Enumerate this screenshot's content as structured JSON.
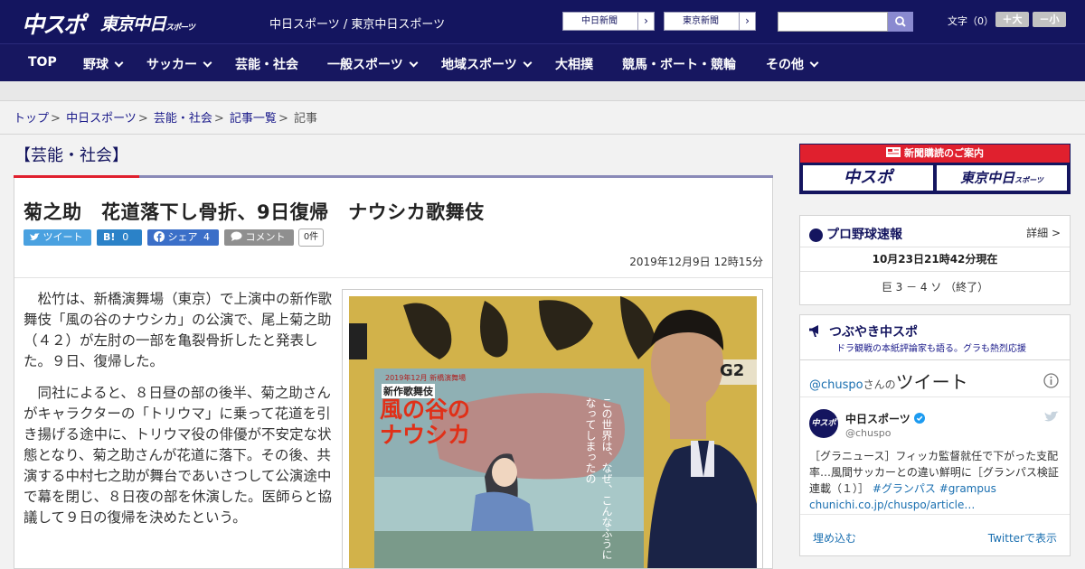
{
  "header": {
    "logo_chuspo": "中スポ",
    "logo_tokyo": "東京中日",
    "logo_tokyo_small": "スポーツ",
    "site_names": "中日スポーツ / 東京中日スポーツ",
    "paper1": "中日新聞",
    "paper2": "東京新聞",
    "arrow": "›",
    "font_label": "文字（0）",
    "font_up": "＋大",
    "font_down": "－小",
    "search_placeholder": ""
  },
  "nav": [
    {
      "label": "TOP",
      "chev": false
    },
    {
      "label": "野球",
      "chev": true
    },
    {
      "label": "サッカー",
      "chev": true
    },
    {
      "label": "芸能・社会",
      "chev": false
    },
    {
      "label": "一般スポーツ",
      "chev": true
    },
    {
      "label": "地域スポーツ",
      "chev": true
    },
    {
      "label": "大相撲",
      "chev": false
    },
    {
      "label": "競馬・ボート・競輪",
      "chev": false
    },
    {
      "label": "その他",
      "chev": true
    }
  ],
  "breadcrumb": {
    "items": [
      "トップ",
      "中日スポーツ",
      "芸能・社会",
      "記事一覧"
    ],
    "current": "記事",
    "sep": ">"
  },
  "section_title": "【芸能・社会】",
  "article": {
    "headline": "菊之助　花道落下し骨折、9日復帰　ナウシカ歌舞伎",
    "tweet": "ツイート",
    "hatena": "B!",
    "hatena_count": "0",
    "fb": "シェア",
    "fb_count": "4",
    "comment": "コメント",
    "comment_count": "0件",
    "date": "2019年12月9日 12時15分",
    "paragraphs": [
      "松竹は、新橋演舞場（東京）で上演中の新作歌舞伎「風の谷のナウシカ」の公演で、尾上菊之助（４２）が左肘の一部を亀裂骨折したと発表した。９日、復帰した。",
      "同社によると、８日昼の部の後半、菊之助さんがキャラクターの「トリウマ」に乗って花道を引き揚げる途中に、トリウマ役の俳優が不安定な状態となり、菊之助さんが花道に落下。その後、共演する中村七之助が舞台であいさつして公演途中で幕を閉じ、８日夜の部を休演した。医師らと協議して９日の復帰を決めたという。"
    ],
    "photo": {
      "poster_title": "風の谷のナウシカ",
      "poster_sub": "新作歌舞伎",
      "poster_date": "2019年12月 新橋演舞場",
      "poster_tag": "G2",
      "poster_vertical": "この世界は、なぜ、こんなふうになってしまったの"
    }
  },
  "sidebar": {
    "banner_top": "新聞購読のご案内",
    "banner_logo1": "中スポ",
    "banner_logo2": "東京中日",
    "banner_logo2_small": "スポーツ",
    "baseball": {
      "title": "プロ野球速報",
      "detail": "詳細 >",
      "time": "10月23日21時42分現在",
      "score": "巨 3 － 4 ソ （終了）"
    },
    "tweet_widget": {
      "title": "つぶやき中スポ",
      "subtitle": "ドラ観戦の本紙評論家も語る。グラも熱烈応援",
      "handle_prefix": "@chuspo",
      "handle_suffix": "さんの",
      "tweets_label": "ツイート",
      "account_name": "中日スポーツ",
      "account_handle": "@chuspo",
      "tweet_text": "［グラニュース］フィッカ監督就任で下がった支配率…風間サッカーとの違い鮮明に［グランパス検証連載（１）］",
      "tweet_tags": "#グランパス #grampus",
      "tweet_link": "chunichi.co.jp/chuspo/article…",
      "embed": "埋め込む",
      "view_on_twitter": "Twitterで表示"
    }
  },
  "colors": {
    "header_bg": "#14155f",
    "accent_red": "#e0202e",
    "link": "#1a1a8a"
  }
}
